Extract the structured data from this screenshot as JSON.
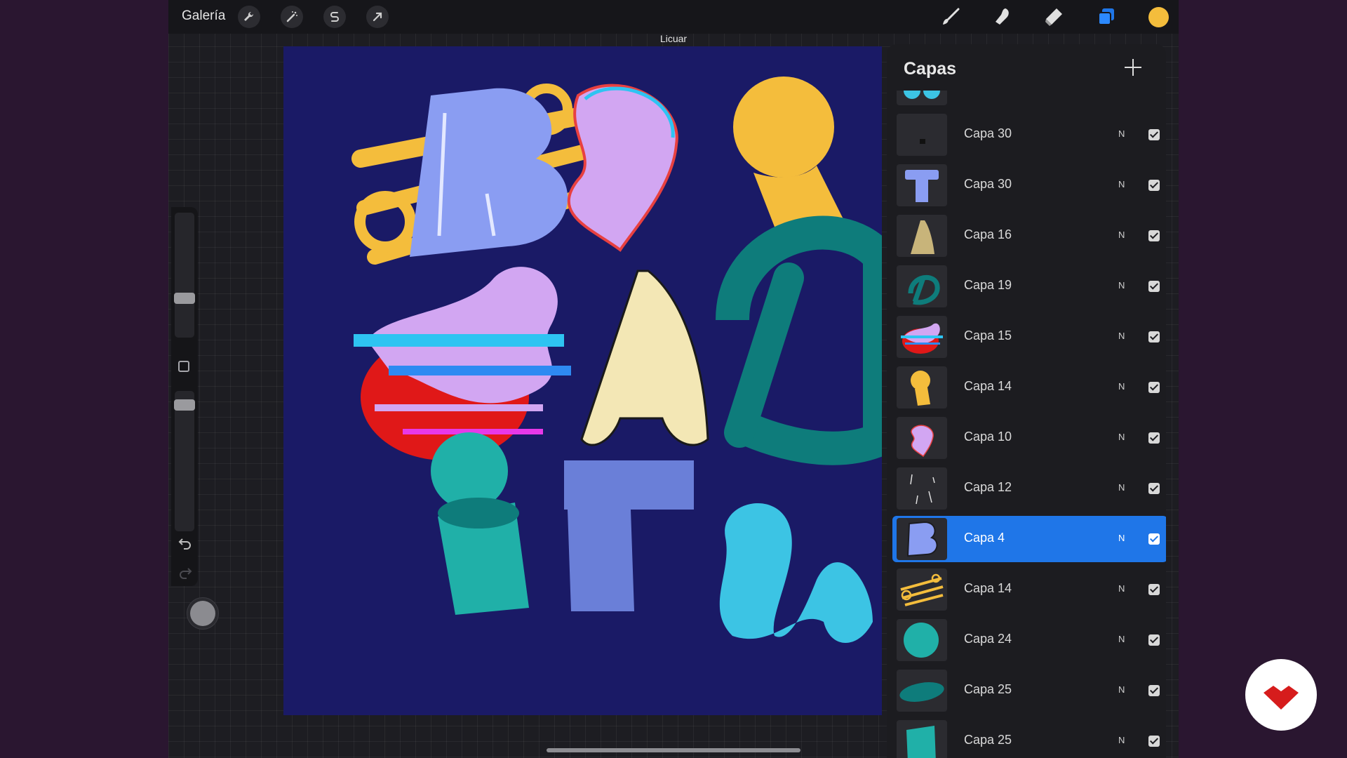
{
  "topbar": {
    "gallery_label": "Galería",
    "left_tools": [
      "wrench-icon",
      "magic-wand-icon",
      "selection-s-icon",
      "transform-arrow-icon"
    ],
    "right_tools": [
      "brush-icon",
      "smudge-icon",
      "eraser-icon",
      "layers-icon",
      "color-swatch"
    ]
  },
  "mode_label": "Licuar",
  "colors": {
    "accent_blue": "#1f76e8",
    "current_color": "#f4bd3c",
    "canvas_bg": "#1a1a66",
    "backdrop": "#2a1630",
    "logo_red": "#d61c1c"
  },
  "layers_panel": {
    "title": "Capas",
    "add_icon": "plus-icon",
    "layers": [
      {
        "name": "Capa 30",
        "mode": "N",
        "visible": true,
        "selected": false,
        "thumb": "t-small"
      },
      {
        "name": "Capa 30",
        "mode": "N",
        "visible": true,
        "selected": false,
        "thumb": "t-blue"
      },
      {
        "name": "Capa 16",
        "mode": "N",
        "visible": true,
        "selected": false,
        "thumb": "a-leopard"
      },
      {
        "name": "Capa 19",
        "mode": "N",
        "visible": true,
        "selected": false,
        "thumb": "d-teal"
      },
      {
        "name": "Capa 15",
        "mode": "N",
        "visible": true,
        "selected": false,
        "thumb": "glitch"
      },
      {
        "name": "Capa 14",
        "mode": "N",
        "visible": true,
        "selected": false,
        "thumb": "yellow-i"
      },
      {
        "name": "Capa 10",
        "mode": "N",
        "visible": true,
        "selected": false,
        "thumb": "a-lilac"
      },
      {
        "name": "Capa 12",
        "mode": "N",
        "visible": true,
        "selected": false,
        "thumb": "strokes"
      },
      {
        "name": "Capa 4",
        "mode": "N",
        "visible": true,
        "selected": true,
        "thumb": "b-blue"
      },
      {
        "name": "Capa 14",
        "mode": "N",
        "visible": true,
        "selected": false,
        "thumb": "yellow-swirls"
      },
      {
        "name": "Capa 24",
        "mode": "N",
        "visible": true,
        "selected": false,
        "thumb": "teal-circle"
      },
      {
        "name": "Capa 25",
        "mode": "N",
        "visible": true,
        "selected": false,
        "thumb": "teal-ellipse"
      },
      {
        "name": "Capa 25",
        "mode": "N",
        "visible": true,
        "selected": false,
        "thumb": "teal-block"
      }
    ]
  },
  "artwork_letters": [
    "B",
    "a",
    "i",
    "&",
    "A",
    "D",
    "i",
    "T",
    "n"
  ]
}
